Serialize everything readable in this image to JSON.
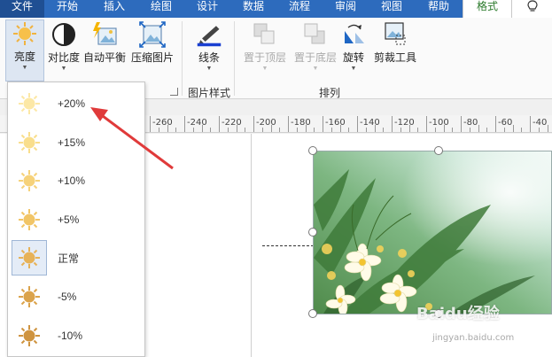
{
  "tabs": [
    "文件",
    "开始",
    "插入",
    "绘图",
    "设计",
    "数据",
    "流程",
    "审阅",
    "视图",
    "帮助",
    "格式"
  ],
  "active_tab": "格式",
  "ribbon": {
    "brightness": "亮度",
    "contrast": "对比度",
    "auto_balance": "自动平衡",
    "compress": "压缩图片",
    "line": "线条",
    "bring_front": "置于顶层",
    "send_back": "置于底层",
    "rotate": "旋转",
    "crop": "剪裁工具",
    "group_picture_style": "图片样式",
    "group_arrange": "排列"
  },
  "ruler_labels": [
    "-260",
    "-240",
    "-220",
    "-200",
    "-180",
    "-160",
    "-140",
    "-120",
    "-100",
    "-80",
    "-60",
    "-40"
  ],
  "brightness_options": [
    "+20%",
    "+15%",
    "+10%",
    "+5%",
    "正常",
    "-5%",
    "-10%"
  ],
  "selected_option": "正常",
  "colors": {
    "tab_bar": "#2d6bbd",
    "active_tab_text": "#2b7a2b",
    "arrow": "#e03a3a",
    "line_icon": "#1a3fd1"
  },
  "watermark": {
    "main": "Baidu经验",
    "sub": "jingyan.baidu.com"
  }
}
